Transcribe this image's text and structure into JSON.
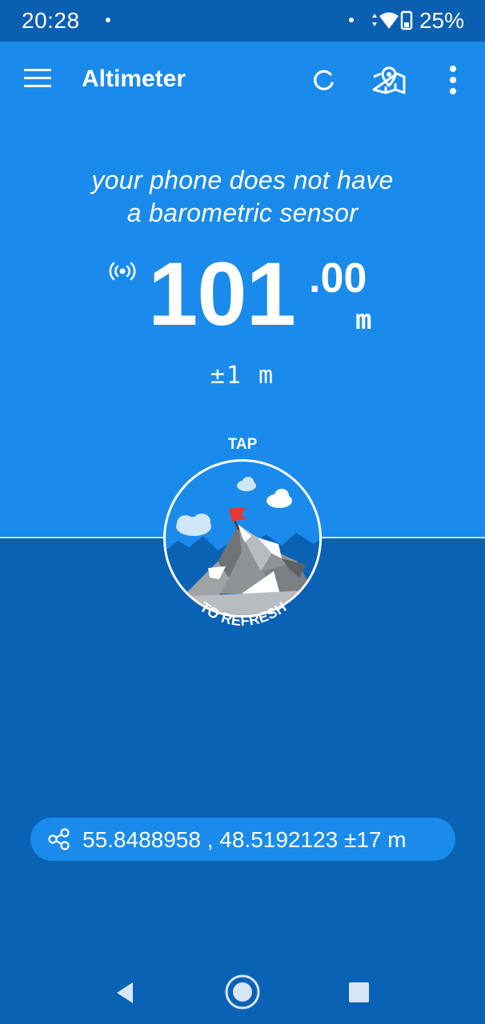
{
  "status_bar": {
    "time": "20:28",
    "battery": "25%"
  },
  "app_bar": {
    "title": "Altimeter",
    "menu_icon": "hamburger-menu-icon",
    "refresh_icon": "refresh-icon",
    "map_icon": "map-pin-icon",
    "overflow_icon": "more-vert-icon"
  },
  "main": {
    "sensor_message_line1": "your phone does not have",
    "sensor_message_line2": "a barometric sensor",
    "altitude_integer": "101",
    "altitude_decimal": ".00",
    "altitude_unit": "m",
    "accuracy": "±1 m"
  },
  "refresh_button": {
    "top_label": "TAP",
    "bottom_label": "TO REFRESH"
  },
  "location": {
    "coordinates": "55.8488958 , 48.5192123 ±17 m"
  },
  "colors": {
    "sky_blue": "#1a8bea",
    "deep_blue": "#0a62b5",
    "flag_red": "#e53935"
  }
}
